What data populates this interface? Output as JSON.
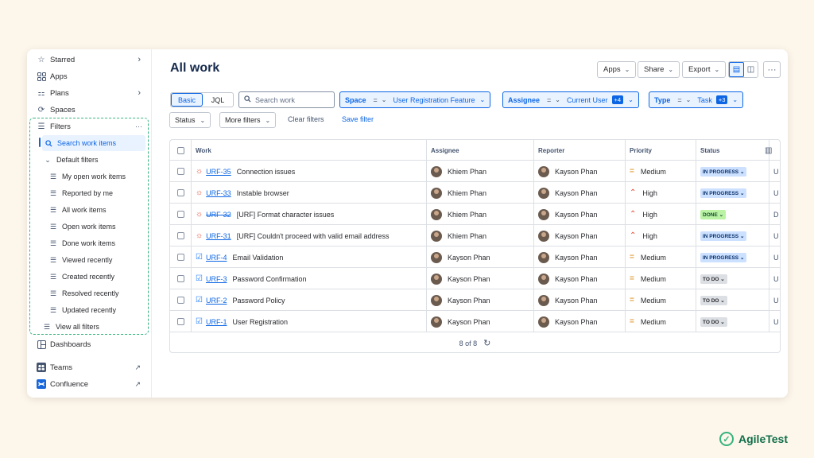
{
  "sidebar": {
    "starred": "Starred",
    "apps": "Apps",
    "plans": "Plans",
    "spaces": "Spaces",
    "filters": "Filters",
    "filters_more": "···",
    "search_work_items": "Search work items",
    "default_filters": "Default filters",
    "default_items": [
      "My open work items",
      "Reported by me",
      "All work items",
      "Open work items",
      "Done work items",
      "Viewed recently",
      "Created recently",
      "Resolved recently",
      "Updated recently"
    ],
    "view_all_filters": "View all filters",
    "dashboards": "Dashboards",
    "teams": "Teams",
    "confluence": "Confluence"
  },
  "header": {
    "title": "All work",
    "apps": "Apps",
    "share": "Share",
    "export": "Export",
    "more": "···"
  },
  "filterbar": {
    "basic": "Basic",
    "jql": "JQL",
    "search_placeholder": "Search work",
    "space_key": "Space",
    "space_op": "=",
    "space_value": "User Registration Feature",
    "assignee_key": "Assignee",
    "assignee_op": "=",
    "assignee_value": "Current User",
    "assignee_badge": "+4",
    "type_key": "Type",
    "type_op": "=",
    "type_value": "Task",
    "type_badge": "+3",
    "status": "Status",
    "more_filters": "More filters",
    "clear_filters": "Clear filters",
    "save_filter": "Save filter"
  },
  "table": {
    "columns": [
      "Work",
      "Assignee",
      "Reporter",
      "Priority",
      "Status"
    ],
    "rows": [
      {
        "type": "bug",
        "key": "URF-35",
        "done": false,
        "summary": "Connection issues",
        "assignee": "Khiem Phan",
        "reporter": "Kayson Phan",
        "priority": "Medium",
        "status": "IN PROGRESS",
        "extra": "U"
      },
      {
        "type": "bug",
        "key": "URF-33",
        "done": false,
        "summary": "Instable browser",
        "assignee": "Khiem Phan",
        "reporter": "Kayson Phan",
        "priority": "High",
        "status": "IN PROGRESS",
        "extra": "U"
      },
      {
        "type": "bug",
        "key": "URF-32",
        "done": true,
        "summary": "[URF] Format character issues",
        "assignee": "Khiem Phan",
        "reporter": "Kayson Phan",
        "priority": "High",
        "status": "DONE",
        "extra": "D"
      },
      {
        "type": "bug",
        "key": "URF-31",
        "done": false,
        "summary": "[URF] Couldn't proceed with valid email address",
        "assignee": "Khiem Phan",
        "reporter": "Kayson Phan",
        "priority": "High",
        "status": "IN PROGRESS",
        "extra": "U"
      },
      {
        "type": "task",
        "key": "URF-4",
        "done": false,
        "summary": "Email Validation",
        "assignee": "Kayson Phan",
        "reporter": "Kayson Phan",
        "priority": "Medium",
        "status": "IN PROGRESS",
        "extra": "U"
      },
      {
        "type": "task",
        "key": "URF-3",
        "done": false,
        "summary": "Password Confirmation",
        "assignee": "Kayson Phan",
        "reporter": "Kayson Phan",
        "priority": "Medium",
        "status": "TO DO",
        "extra": "U"
      },
      {
        "type": "task",
        "key": "URF-2",
        "done": false,
        "summary": "Password Policy",
        "assignee": "Kayson Phan",
        "reporter": "Kayson Phan",
        "priority": "Medium",
        "status": "TO DO",
        "extra": "U"
      },
      {
        "type": "task",
        "key": "URF-1",
        "done": false,
        "summary": "User Registration",
        "assignee": "Kayson Phan",
        "reporter": "Kayson Phan",
        "priority": "Medium",
        "status": "TO DO",
        "extra": "U"
      }
    ],
    "footer_count": "8 of 8"
  },
  "brand": {
    "name": "AgileTest"
  },
  "colors": {
    "accent": "#0c66e4",
    "filter_outline": "#36b37e",
    "background": "#fdf6ea"
  }
}
